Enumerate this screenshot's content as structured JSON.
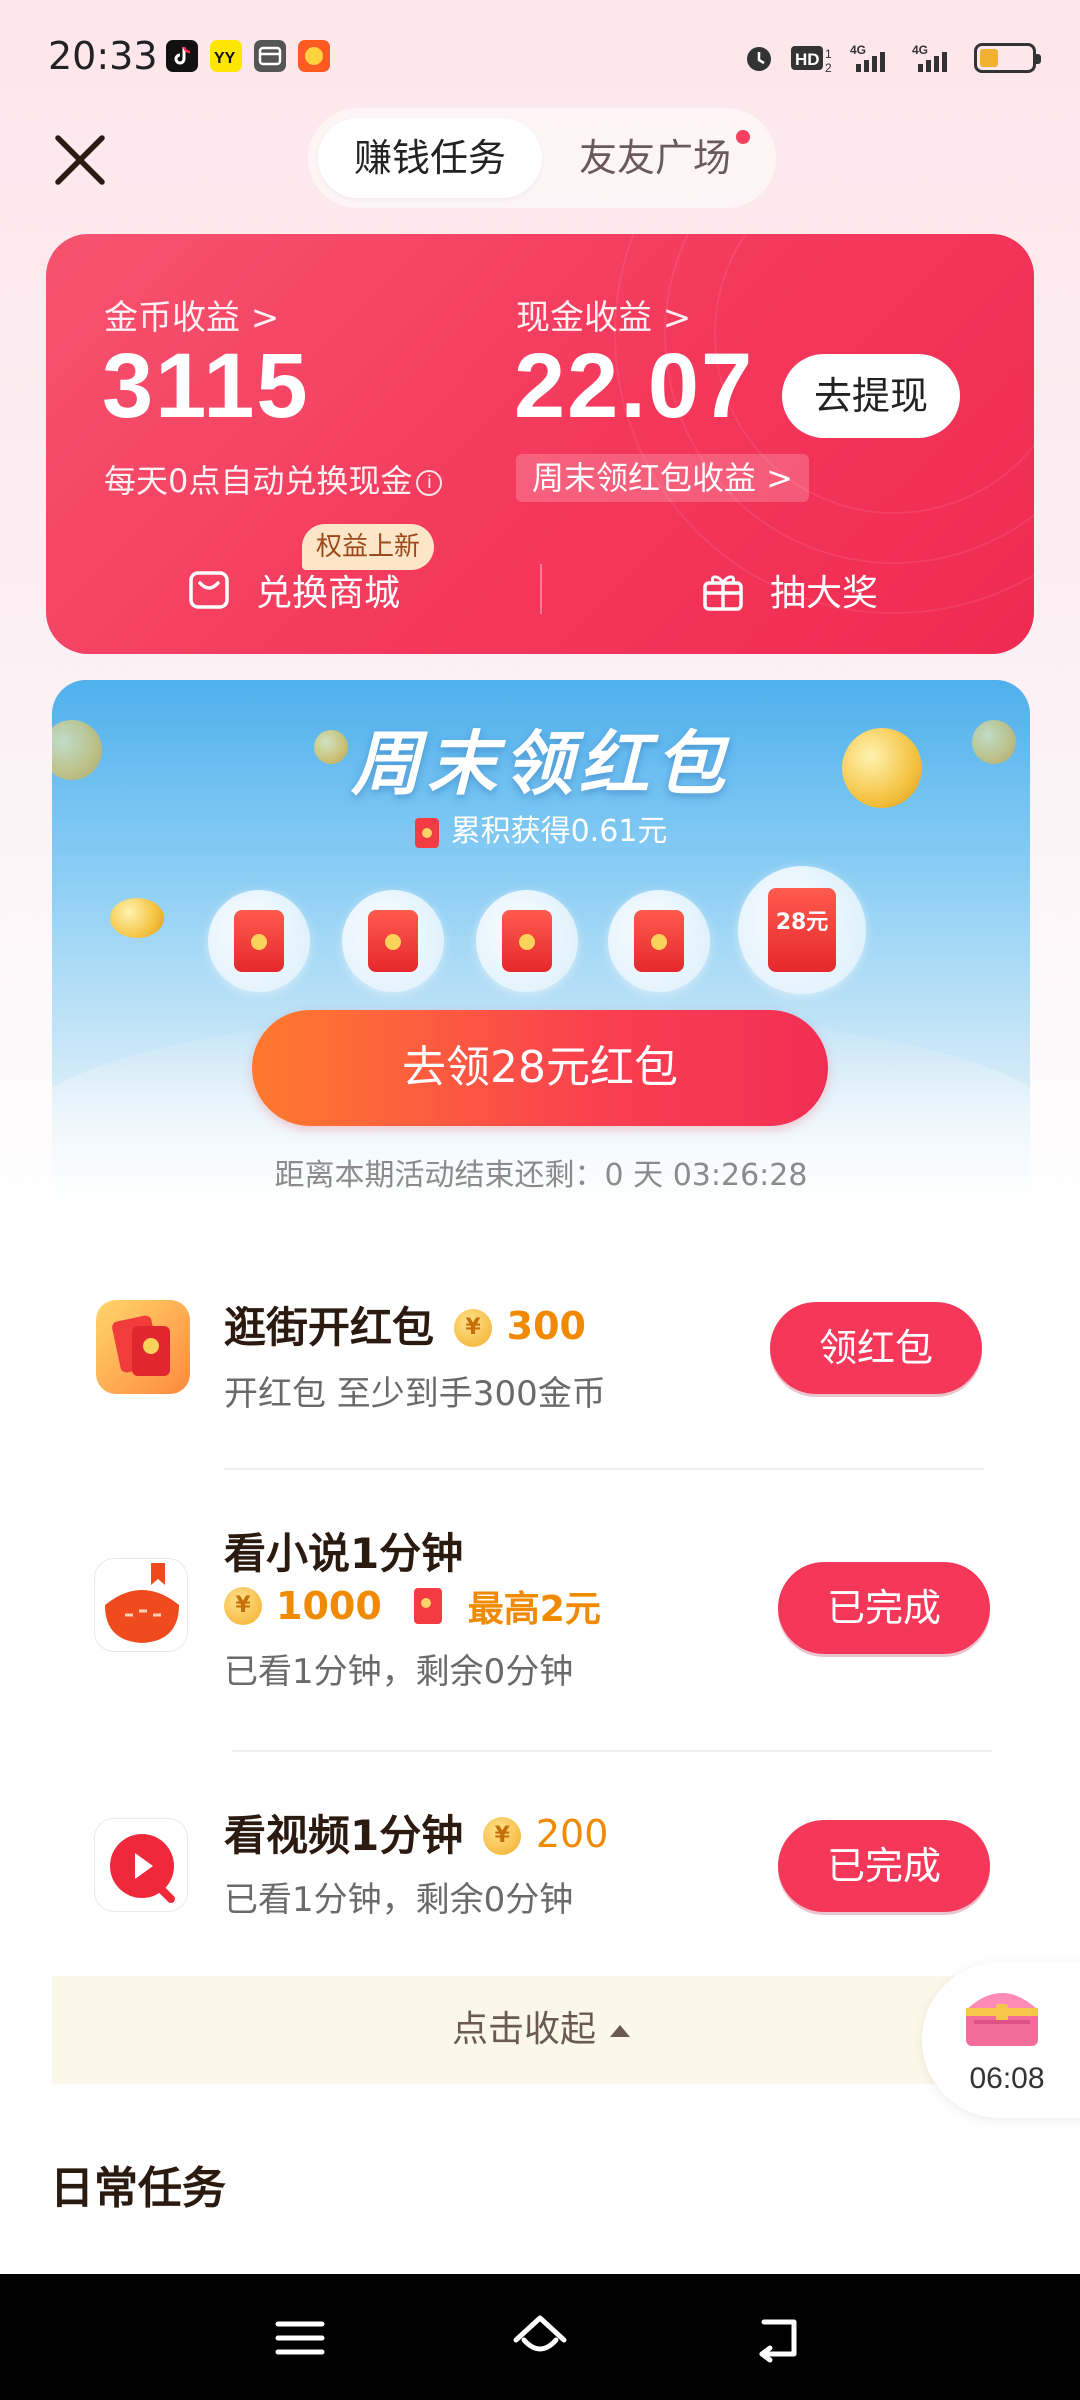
{
  "status_bar": {
    "time": "20:33",
    "apps": [
      "tiktok-icon",
      "yy-icon",
      "wallet-icon",
      "taobao-icon"
    ],
    "right_icons": [
      "alarm-icon",
      "hd-icon",
      "signal-4g-icon",
      "signal-4g-icon"
    ],
    "battery_level": 0.35
  },
  "header": {
    "tabs": [
      {
        "label": "赚钱任务",
        "active": true
      },
      {
        "label": "友友广场",
        "active": false,
        "has_dot": true
      }
    ]
  },
  "earnings": {
    "coin_label": "金币收益 >",
    "coin_value": "3115",
    "cash_label": "现金收益 >",
    "cash_value": "22.07",
    "withdraw_button": "去提现",
    "auto_exchange_note": "每天0点自动兑换现金",
    "weekend_tag": "周末领红包收益 >",
    "mall_label": "兑换商城",
    "mall_badge": "权益上新",
    "lottery_label": "抽大奖"
  },
  "weekend_banner": {
    "title": "周末领红包",
    "accumulated": "累积获得0.61元",
    "big_packet_amount": "28元",
    "claim_button": "去领28元红包",
    "countdown": "距离本期活动结束还剩：0 天 03:26:28"
  },
  "tasks": [
    {
      "title": "逛街开红包",
      "coins": "300",
      "desc": "开红包 至少到手300金币",
      "button": "领红包"
    },
    {
      "title": "看小说1分钟",
      "coins": "1000",
      "bonus": "最高2元",
      "desc": "已看1分钟，剩余0分钟",
      "button": "已完成"
    },
    {
      "title": "看视频1分钟",
      "coins": "200",
      "desc": "已看1分钟，剩余0分钟",
      "button": "已完成"
    }
  ],
  "collapse_label": "点击收起",
  "treasure_timer": "06:08",
  "daily_tasks_title": "日常任务",
  "colors": {
    "accent": "#f5385a",
    "coin": "#f08a00",
    "card_bg": "#f4385b"
  }
}
